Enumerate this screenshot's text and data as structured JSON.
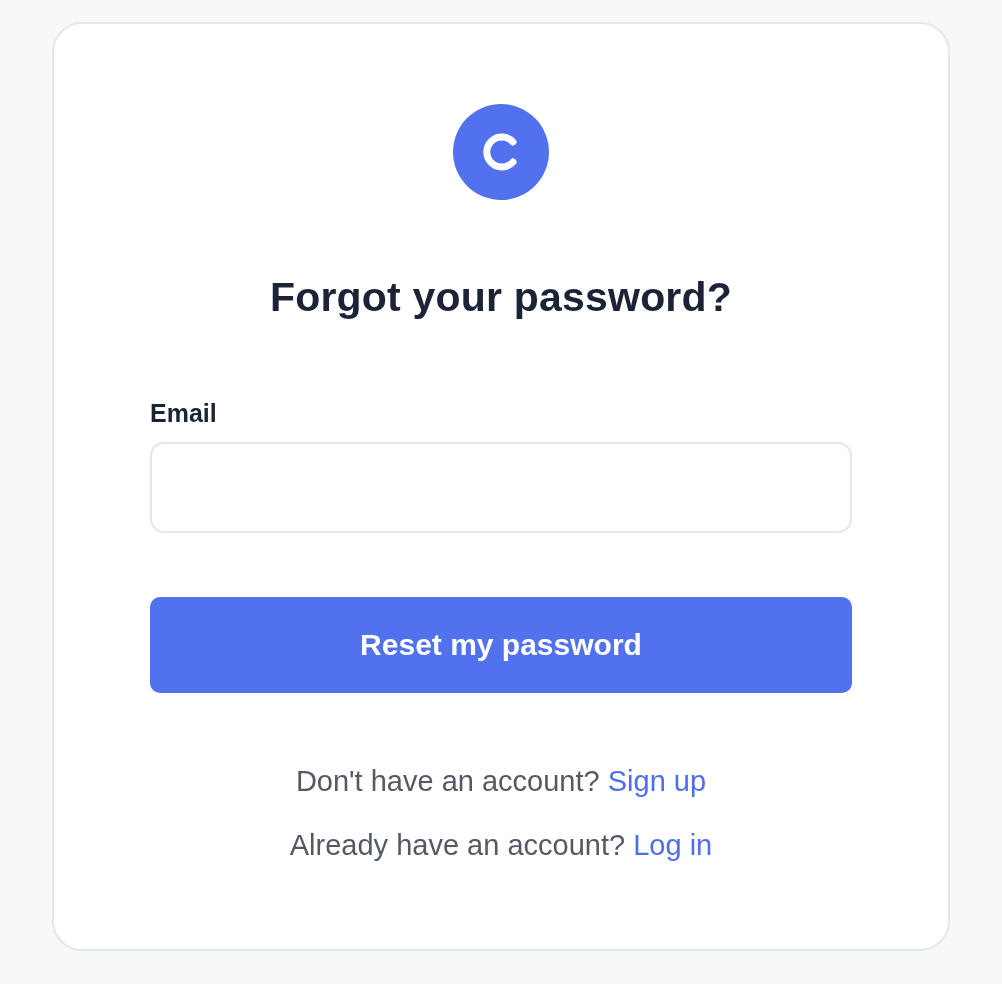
{
  "title": "Forgot your password?",
  "email": {
    "label": "Email"
  },
  "submit_button": {
    "label": "Reset my password"
  },
  "prompts": [
    {
      "text": "Don't have an account?",
      "link": "Sign up"
    },
    {
      "text": "Already have an account?",
      "link": "Log in"
    }
  ]
}
